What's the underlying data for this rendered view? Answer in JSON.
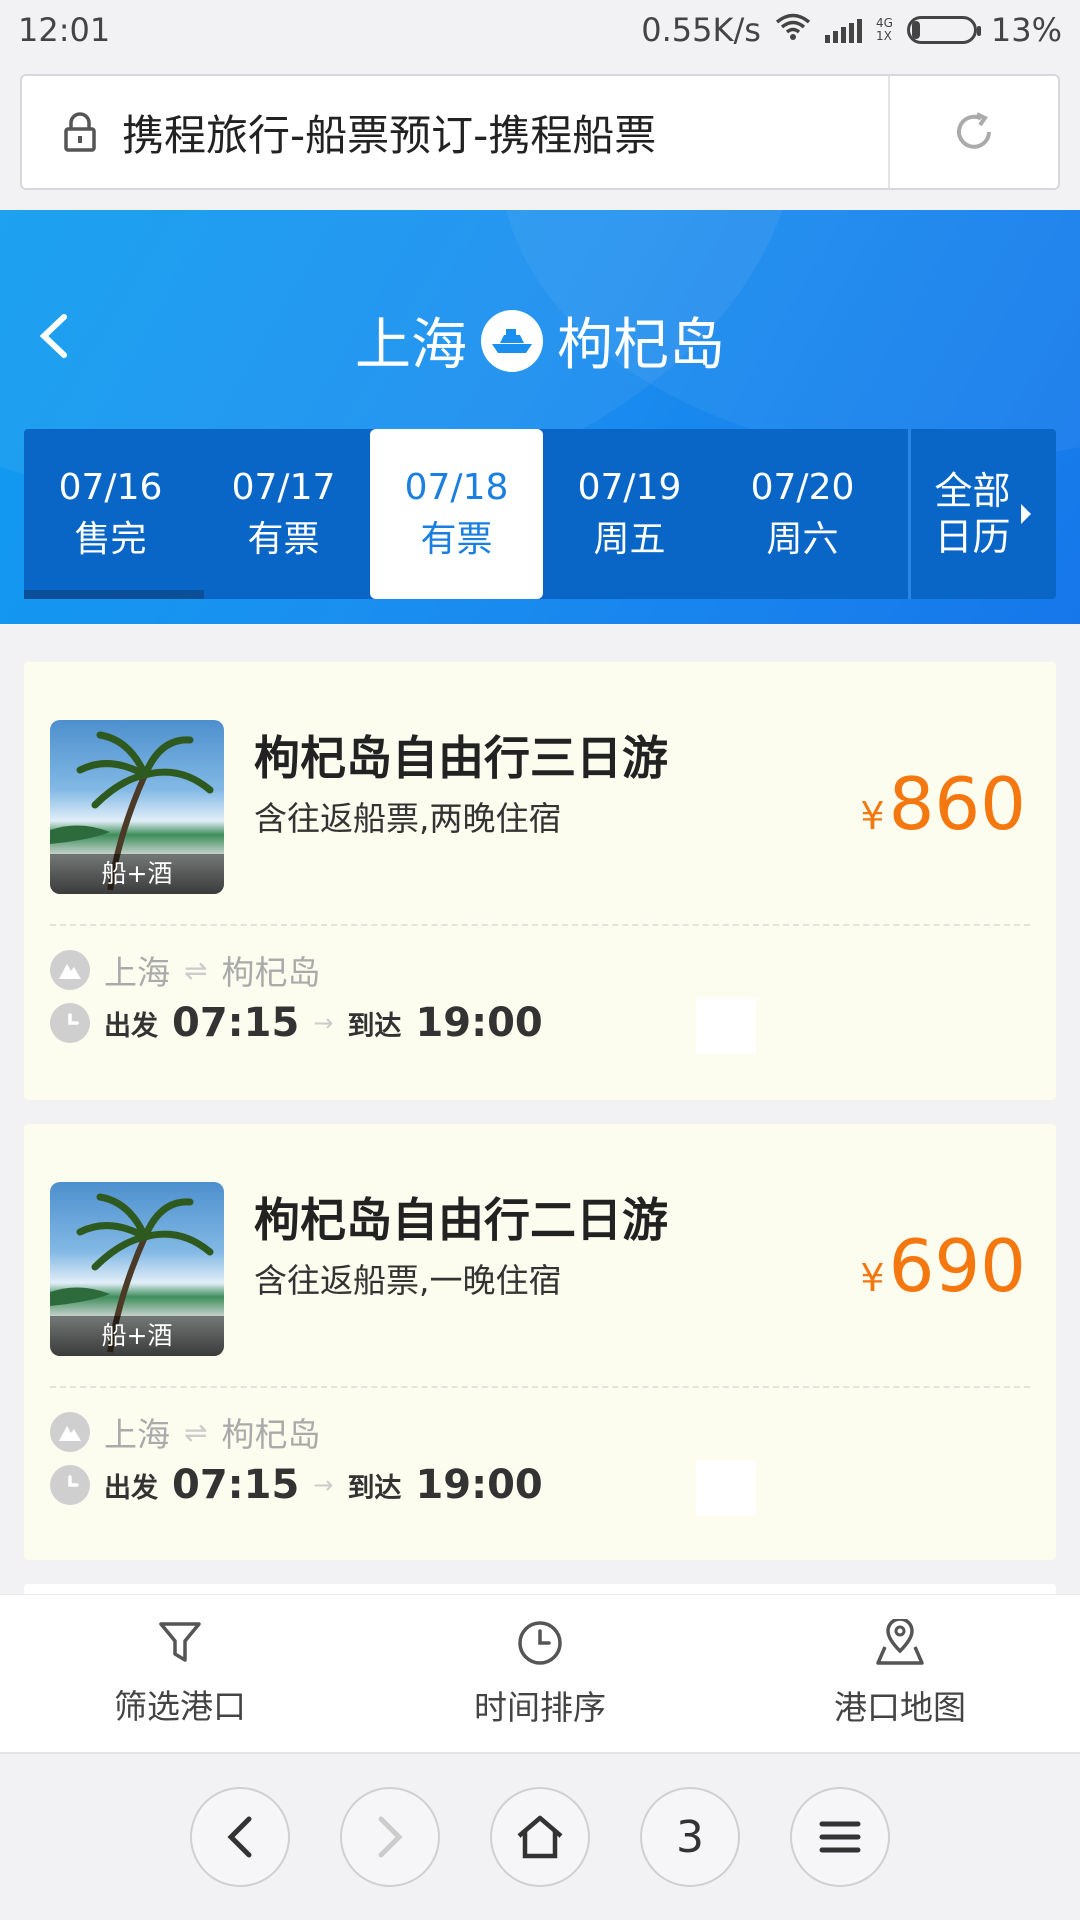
{
  "status_bar": {
    "time": "12:01",
    "speed": "0.55K/s",
    "network_top": "4G",
    "network_bottom": "1X",
    "battery": "13%"
  },
  "address_bar": {
    "url_title": "携程旅行-船票预订-携程船票"
  },
  "header": {
    "from": "上海",
    "to": "枸杞岛",
    "dates": [
      {
        "date": "07/16",
        "status": "售完"
      },
      {
        "date": "07/17",
        "status": "有票"
      },
      {
        "date": "07/18",
        "status": "有票"
      },
      {
        "date": "07/19",
        "status": "周五"
      },
      {
        "date": "07/20",
        "status": "周六"
      }
    ],
    "calendar_line1": "全部",
    "calendar_line2": "日历"
  },
  "cards": [
    {
      "title": "枸杞岛自由行三日游",
      "desc": "含往返船票,两晚住宿",
      "tag": "船+酒",
      "currency": "¥",
      "price": "860",
      "route_from": "上海",
      "route_to": "枸杞岛",
      "depart_label": "出发",
      "depart_time": "07:15",
      "arrive_label": "到达",
      "arrive_time": "19:00"
    },
    {
      "title": "枸杞岛自由行二日游",
      "desc": "含往返船票,一晚住宿",
      "tag": "船+酒",
      "currency": "¥",
      "price": "690",
      "route_from": "上海",
      "route_to": "枸杞岛",
      "depart_label": "出发",
      "depart_time": "07:15",
      "arrive_label": "到达",
      "arrive_time": "19:00"
    }
  ],
  "tools": [
    {
      "label": "筛选港口",
      "icon": "filter-icon"
    },
    {
      "label": "时间排序",
      "icon": "clock-icon"
    },
    {
      "label": "港口地图",
      "icon": "map-pin-icon"
    }
  ],
  "browser_nav": {
    "tabs_count": "3"
  },
  "colors": {
    "accent_blue": "#1a8ff0",
    "price_orange": "#f5770f",
    "card_bg": "#fcfdef"
  }
}
